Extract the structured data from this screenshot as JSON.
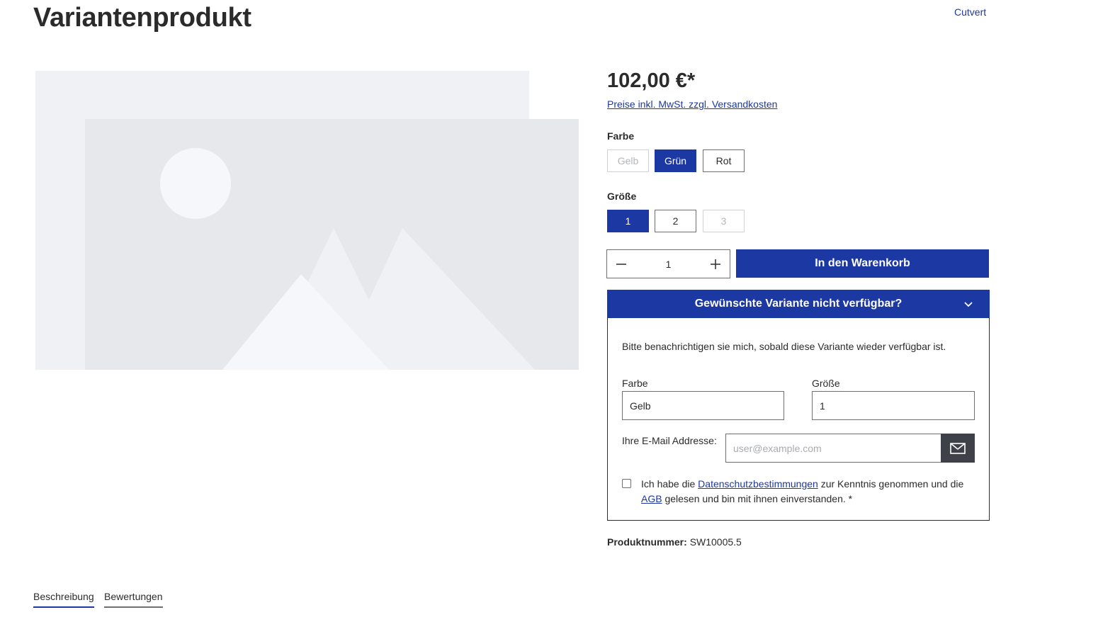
{
  "product": {
    "title": "Variantenprodukt",
    "manufacturer": "Cutvert",
    "price": "102,00 €*",
    "tax_note": "Preise inkl. MwSt. zzgl. Versandkosten",
    "product_number_label": "Produktnummer:",
    "product_number": "SW10005.5"
  },
  "options": {
    "color": {
      "label": "Farbe",
      "values": [
        {
          "label": "Gelb",
          "state": "disabled"
        },
        {
          "label": "Grün",
          "state": "active"
        },
        {
          "label": "Rot",
          "state": "normal"
        }
      ]
    },
    "size": {
      "label": "Größe",
      "values": [
        {
          "label": "1",
          "state": "active"
        },
        {
          "label": "2",
          "state": "normal"
        },
        {
          "label": "3",
          "state": "disabled"
        }
      ]
    }
  },
  "buy": {
    "quantity": "1",
    "minus_symbol": "−",
    "plus_symbol": "+",
    "button_label": "In den Warenkorb"
  },
  "notify": {
    "header": "Gewünschte Variante nicht verfügbar?",
    "intro": "Bitte benachrichtigen sie mich, sobald diese Variante wieder verfügbar ist.",
    "color_label": "Farbe",
    "color_value": "Gelb",
    "size_label": "Größe",
    "size_value": "1",
    "email_label": "Ihre E-Mail Addresse:",
    "email_placeholder": "user@example.com",
    "consent_part1": "Ich habe die ",
    "consent_link1": "Datenschutzbestimmungen",
    "consent_part2": " zur Kenntnis genommen und die ",
    "consent_link2": "AGB",
    "consent_part3": " gelesen und bin mit ihnen einverstanden. *"
  },
  "tabs": [
    {
      "label": "Beschreibung"
    },
    {
      "label": "Bewertungen"
    }
  ],
  "colors": {
    "accent": "#1c38a3",
    "placeholder_bg": "#f0f1f5",
    "placeholder_fg": "#e6e8ec",
    "submit_bg": "#3e4248"
  },
  "icons": {
    "notify_toggle": "chevron-down-icon",
    "email_submit": "envelope-icon",
    "gallery": "image-placeholder-icon"
  }
}
